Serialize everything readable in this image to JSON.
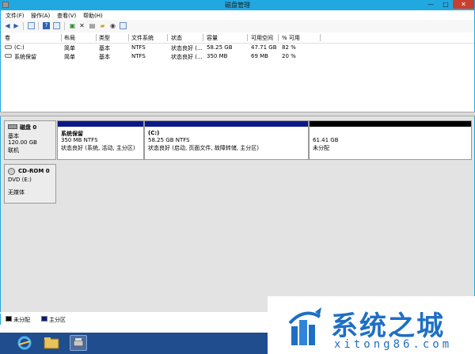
{
  "window": {
    "title": "磁盘管理",
    "min": "—",
    "max": "□",
    "close": "✕"
  },
  "menu": [
    "文件(F)",
    "操作(A)",
    "查看(V)",
    "帮助(H)"
  ],
  "toolbar_icons": [
    "back-icon",
    "forward-icon",
    "up-icon",
    "properties-icon",
    "help-icon",
    "refresh-icon",
    "check-icon",
    "delete-icon",
    "open-icon",
    "folder-icon",
    "search-icon",
    "settings-icon"
  ],
  "volume_table": {
    "columns": [
      "卷",
      "布局",
      "类型",
      "文件系统",
      "状态",
      "容量",
      "可用空间",
      "% 可用"
    ],
    "rows": [
      [
        "(C:)",
        "简单",
        "基本",
        "NTFS",
        "状态良好 (...",
        "58.25 GB",
        "47.71 GB",
        "82 %"
      ],
      [
        "系统保留",
        "简单",
        "基本",
        "NTFS",
        "状态良好 (...",
        "350 MB",
        "69 MB",
        "20 %"
      ]
    ]
  },
  "disks": [
    {
      "name": "磁盘 0",
      "type": "基本",
      "size": "120.00 GB",
      "status": "联机",
      "partitions": [
        {
          "name": "系统保留",
          "size": "350 MB NTFS",
          "status": "状态良好 (系统, 活动, 主分区)",
          "kind": "primary"
        },
        {
          "name": "(C:)",
          "size": "58.25 GB NTFS",
          "status": "状态良好 (启动, 页面文件, 故障转储, 主分区)",
          "kind": "primary"
        },
        {
          "name": "",
          "size": "61.41 GB",
          "status": "未分配",
          "kind": "unallocated"
        }
      ]
    },
    {
      "name": "CD-ROM 0",
      "type": "DVD (E:)",
      "status": "无媒体"
    }
  ],
  "legend": [
    {
      "label": "未分配",
      "color": "#000000"
    },
    {
      "label": "主分区",
      "color": "#0a1a8a"
    }
  ],
  "watermark": {
    "text": "系统之城",
    "url": "xitong86.com"
  },
  "colors": {
    "titlebar": "#22a8e0",
    "primary": "#0a1a8a",
    "unallocated": "#000000",
    "taskbar": "#1f4d8d"
  }
}
